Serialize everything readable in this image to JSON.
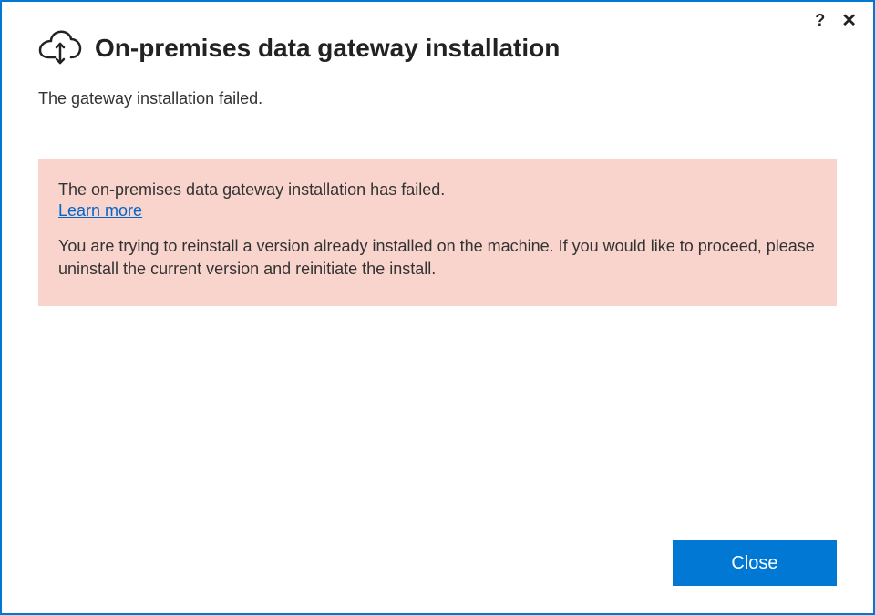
{
  "titlebar": {
    "help_label": "?",
    "close_label": "✕"
  },
  "header": {
    "title": "On-premises data gateway installation",
    "icon": "cloud-sync-icon"
  },
  "content": {
    "status_text": "The gateway installation failed.",
    "error": {
      "message": "The on-premises data gateway installation has failed.",
      "learn_more_label": "Learn more",
      "detail": "You are trying to reinstall a version already installed on the machine. If you would like to proceed, please uninstall the current version and reinitiate the install."
    }
  },
  "footer": {
    "close_button_label": "Close"
  },
  "colors": {
    "accent": "#0078d4",
    "error_bg": "#f8d4cc",
    "link": "#0066cc"
  }
}
